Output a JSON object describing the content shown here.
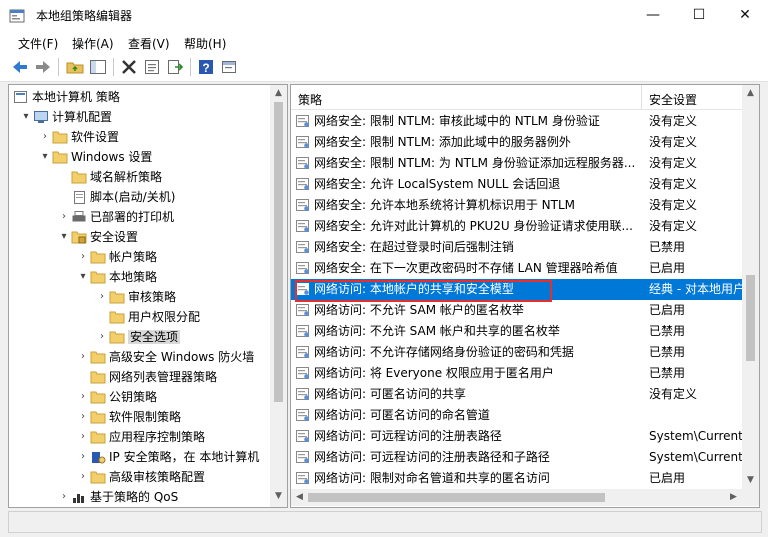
{
  "window": {
    "title": "本地组策略编辑器",
    "minimize": "—",
    "maximize": "☐",
    "close": "✕"
  },
  "menu": [
    "文件(F)",
    "操作(A)",
    "查看(V)",
    "帮助(H)"
  ],
  "tree": {
    "root": "本地计算机 策略",
    "items": [
      {
        "label": "计算机配置"
      },
      {
        "label": "软件设置"
      },
      {
        "label": "Windows 设置"
      },
      {
        "label": "域名解析策略"
      },
      {
        "label": "脚本(启动/关机)"
      },
      {
        "label": "已部署的打印机"
      },
      {
        "label": "安全设置"
      },
      {
        "label": "帐户策略"
      },
      {
        "label": "本地策略"
      },
      {
        "label": "审核策略"
      },
      {
        "label": "用户权限分配"
      },
      {
        "label": "安全选项"
      },
      {
        "label": "高级安全 Windows 防火墙"
      },
      {
        "label": "网络列表管理器策略"
      },
      {
        "label": "公钥策略"
      },
      {
        "label": "软件限制策略"
      },
      {
        "label": "应用程序控制策略"
      },
      {
        "label": "IP 安全策略，在 本地计算机"
      },
      {
        "label": "高级审核策略配置"
      },
      {
        "label": "基于策略的 QoS"
      }
    ]
  },
  "list": {
    "col_policy": "策略",
    "col_setting": "安全设置",
    "rows": [
      {
        "policy": "网络安全: 限制 NTLM: 审核此域中的 NTLM 身份验证",
        "setting": "没有定义"
      },
      {
        "policy": "网络安全: 限制 NTLM: 添加此域中的服务器例外",
        "setting": "没有定义"
      },
      {
        "policy": "网络安全: 限制 NTLM: 为 NTLM 身份验证添加远程服务器...",
        "setting": "没有定义"
      },
      {
        "policy": "网络安全: 允许 LocalSystem NULL 会话回退",
        "setting": "没有定义"
      },
      {
        "policy": "网络安全: 允许本地系统将计算机标识用于 NTLM",
        "setting": "没有定义"
      },
      {
        "policy": "网络安全: 允许对此计算机的 PKU2U 身份验证请求使用联...",
        "setting": "没有定义"
      },
      {
        "policy": "网络安全: 在超过登录时间后强制注销",
        "setting": "已禁用"
      },
      {
        "policy": "网络安全: 在下一次更改密码时不存储 LAN 管理器哈希值",
        "setting": "已启用"
      },
      {
        "policy": "网络访问: 本地帐户的共享和安全模型",
        "setting": "经典 - 对本地用户"
      },
      {
        "policy": "网络访问: 不允许 SAM 帐户的匿名枚举",
        "setting": "已启用"
      },
      {
        "policy": "网络访问: 不允许 SAM 帐户和共享的匿名枚举",
        "setting": "已禁用"
      },
      {
        "policy": "网络访问: 不允许存储网络身份验证的密码和凭据",
        "setting": "已禁用"
      },
      {
        "policy": "网络访问: 将 Everyone 权限应用于匿名用户",
        "setting": "已禁用"
      },
      {
        "policy": "网络访问: 可匿名访问的共享",
        "setting": "没有定义"
      },
      {
        "policy": "网络访问: 可匿名访问的命名管道",
        "setting": ""
      },
      {
        "policy": "网络访问: 可远程访问的注册表路径",
        "setting": "System\\CurrentC"
      },
      {
        "policy": "网络访问: 可远程访问的注册表路径和子路径",
        "setting": "System\\CurrentC"
      },
      {
        "policy": "网络访问: 限制对命名管道和共享的匿名访问",
        "setting": "已启用"
      }
    ]
  },
  "colors": {
    "selection": "#0078d7",
    "highlight_box": "#e63030",
    "tree_selection": "#d9d9d9"
  }
}
